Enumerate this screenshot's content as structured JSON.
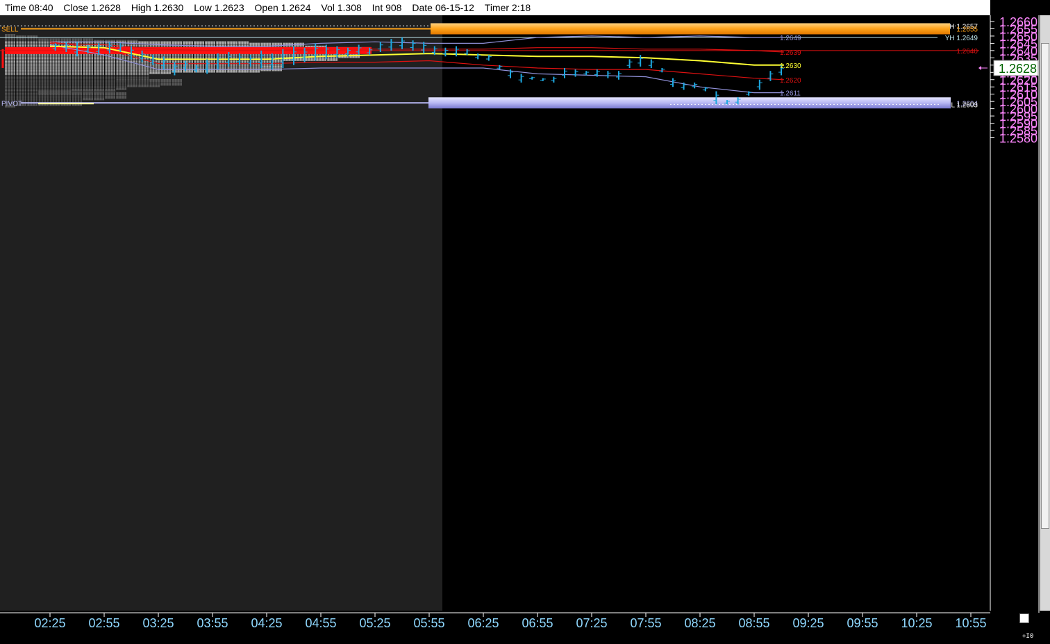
{
  "infobar": {
    "time": "Time 08:40",
    "close": "Close 1.2628",
    "high": "High 1.2630",
    "low": "Low 1.2623",
    "open": "Open 1.2624",
    "vol": "Vol 1.308",
    "int": "Int 908",
    "date": "Date 06-15-12",
    "timer": "Timer 2:18"
  },
  "corner_label": "+I0",
  "colors": {
    "background": "#000000",
    "premarket_shade": "#202020",
    "profile_light": "#a8a8a8",
    "profile_dark": "#565656",
    "bar": "#1ea8e0",
    "yellow": "#ffff33",
    "red": "#dd1111",
    "lavender": "#9090d8",
    "sell_band": "#ffa319",
    "pivot_band": "#b8b8f4",
    "price_axis_text": "#ff88ff",
    "time_axis_text": "#8fd8ff"
  },
  "chart_data": {
    "type": "bar",
    "subtype": "ohlc-price-chart-with-market-profile",
    "ylim": [
      1.2578,
      1.2662
    ],
    "price_ticks": [
      "1.2660",
      "1.2655",
      "1.2650",
      "1.2645",
      "1.2640",
      "1.2635",
      "1.2630",
      "1.2625",
      "1.2620",
      "1.2615",
      "1.2610",
      "1.2605",
      "1.2600",
      "1.2595",
      "1.2590",
      "1.2585",
      "1.2580"
    ],
    "time_ticks": [
      "02:25",
      "02:55",
      "03:25",
      "03:55",
      "04:25",
      "04:55",
      "05:25",
      "05:55",
      "06:25",
      "06:55",
      "07:25",
      "07:55",
      "08:25",
      "08:55",
      "09:25",
      "09:55",
      "10:25",
      "10:55"
    ],
    "current_price": "1.2628",
    "levels": [
      {
        "name": "high",
        "label": "H",
        "value": "1.2657",
        "style": "dotted"
      },
      {
        "name": "sell",
        "label": "SELL",
        "value": "1.2655",
        "style": "band"
      },
      {
        "name": "yesterday-high",
        "label": "YH",
        "value": "1.2649",
        "style": "line"
      },
      {
        "name": "pivot",
        "label": "PIVOT",
        "value": "1.2604",
        "style": "band"
      },
      {
        "name": "low",
        "label": "L",
        "value": "1.2603",
        "style": "dotted"
      },
      {
        "name": "red-level",
        "label": "",
        "value": "1.2640",
        "style": "line"
      }
    ],
    "series_labels": [
      {
        "value": "1.2649",
        "color": "lavender"
      },
      {
        "value": "1.2639",
        "color": "red"
      },
      {
        "value": "1.2630",
        "color": "yellow"
      },
      {
        "value": "1.2620",
        "color": "red"
      },
      {
        "value": "1.2611",
        "color": "lavender"
      }
    ],
    "bars": [
      {
        "x": 0.1,
        "h": 1.2645,
        "l": 1.264
      },
      {
        "x": 0.3,
        "h": 1.2646,
        "l": 1.2639
      },
      {
        "x": 0.5,
        "h": 1.2646,
        "l": 1.2636
      },
      {
        "x": 0.7,
        "h": 1.2644,
        "l": 1.2638
      },
      {
        "x": 0.9,
        "h": 1.2645,
        "l": 1.2637
      },
      {
        "x": 1.1,
        "h": 1.2646,
        "l": 1.2638
      },
      {
        "x": 1.3,
        "h": 1.2645,
        "l": 1.2639
      },
      {
        "x": 1.5,
        "h": 1.2643,
        "l": 1.2634
      },
      {
        "x": 1.7,
        "h": 1.264,
        "l": 1.2632
      },
      {
        "x": 1.9,
        "h": 1.2637,
        "l": 1.263
      },
      {
        "x": 2.1,
        "h": 1.2636,
        "l": 1.2627
      },
      {
        "x": 2.3,
        "h": 1.2632,
        "l": 1.2623
      },
      {
        "x": 2.5,
        "h": 1.2633,
        "l": 1.2626
      },
      {
        "x": 2.7,
        "h": 1.263,
        "l": 1.2625
      },
      {
        "x": 2.9,
        "h": 1.2634,
        "l": 1.2624
      },
      {
        "x": 3.1,
        "h": 1.2638,
        "l": 1.2627
      },
      {
        "x": 3.3,
        "h": 1.2639,
        "l": 1.2629
      },
      {
        "x": 3.5,
        "h": 1.2638,
        "l": 1.263
      },
      {
        "x": 3.7,
        "h": 1.2637,
        "l": 1.2629
      },
      {
        "x": 3.9,
        "h": 1.264,
        "l": 1.2628
      },
      {
        "x": 4.1,
        "h": 1.2638,
        "l": 1.2627
      },
      {
        "x": 4.3,
        "h": 1.2641,
        "l": 1.2628
      },
      {
        "x": 4.5,
        "h": 1.2643,
        "l": 1.263
      },
      {
        "x": 4.7,
        "h": 1.2642,
        "l": 1.2632
      },
      {
        "x": 4.9,
        "h": 1.2645,
        "l": 1.2633
      },
      {
        "x": 5.1,
        "h": 1.2644,
        "l": 1.2634
      },
      {
        "x": 5.3,
        "h": 1.2643,
        "l": 1.2635
      },
      {
        "x": 5.5,
        "h": 1.2642,
        "l": 1.2636
      },
      {
        "x": 5.7,
        "h": 1.2644,
        "l": 1.2637
      },
      {
        "x": 5.9,
        "h": 1.2642,
        "l": 1.2637
      },
      {
        "x": 6.1,
        "h": 1.2646,
        "l": 1.2639
      },
      {
        "x": 6.3,
        "h": 1.2648,
        "l": 1.264
      },
      {
        "x": 6.5,
        "h": 1.2649,
        "l": 1.2641
      },
      {
        "x": 6.7,
        "h": 1.2647,
        "l": 1.264
      },
      {
        "x": 6.9,
        "h": 1.2646,
        "l": 1.2638
      },
      {
        "x": 7.1,
        "h": 1.2643,
        "l": 1.2637
      },
      {
        "x": 7.3,
        "h": 1.2642,
        "l": 1.2636
      },
      {
        "x": 7.5,
        "h": 1.2643,
        "l": 1.2636
      },
      {
        "x": 7.7,
        "h": 1.2641,
        "l": 1.2637
      },
      {
        "x": 7.9,
        "h": 1.2638,
        "l": 1.2634
      },
      {
        "x": 8.1,
        "h": 1.2637,
        "l": 1.2633
      },
      {
        "x": 8.3,
        "h": 1.263,
        "l": 1.2627
      },
      {
        "x": 8.5,
        "h": 1.2627,
        "l": 1.2621
      },
      {
        "x": 8.7,
        "h": 1.2624,
        "l": 1.2618
      },
      {
        "x": 8.9,
        "h": 1.2622,
        "l": 1.262
      },
      {
        "x": 9.1,
        "h": 1.2621,
        "l": 1.2619
      },
      {
        "x": 9.3,
        "h": 1.2622,
        "l": 1.2618
      },
      {
        "x": 9.5,
        "h": 1.2628,
        "l": 1.2621
      },
      {
        "x": 9.7,
        "h": 1.2627,
        "l": 1.2622
      },
      {
        "x": 9.9,
        "h": 1.2626,
        "l": 1.2623
      },
      {
        "x": 10.1,
        "h": 1.2627,
        "l": 1.2622
      },
      {
        "x": 10.3,
        "h": 1.2626,
        "l": 1.2621
      },
      {
        "x": 10.5,
        "h": 1.2626,
        "l": 1.262
      },
      {
        "x": 10.7,
        "h": 1.2634,
        "l": 1.2628
      },
      {
        "x": 10.9,
        "h": 1.2637,
        "l": 1.2629
      },
      {
        "x": 11.1,
        "h": 1.2634,
        "l": 1.2628
      },
      {
        "x": 11.3,
        "h": 1.2628,
        "l": 1.2625
      },
      {
        "x": 11.5,
        "h": 1.2621,
        "l": 1.2615
      },
      {
        "x": 11.7,
        "h": 1.2618,
        "l": 1.2613
      },
      {
        "x": 11.9,
        "h": 1.2618,
        "l": 1.2614
      },
      {
        "x": 12.1,
        "h": 1.2615,
        "l": 1.2612
      },
      {
        "x": 12.3,
        "h": 1.2612,
        "l": 1.2603
      },
      {
        "x": 12.5,
        "h": 1.2606,
        "l": 1.2603
      },
      {
        "x": 12.7,
        "h": 1.2608,
        "l": 1.2603
      },
      {
        "x": 12.9,
        "h": 1.2612,
        "l": 1.2609
      },
      {
        "x": 13.1,
        "h": 1.262,
        "l": 1.2613
      },
      {
        "x": 13.3,
        "h": 1.2626,
        "l": 1.2619
      },
      {
        "x": 13.5,
        "h": 1.263,
        "l": 1.2623
      }
    ],
    "yellow_line": [
      [
        0.0,
        1.2643
      ],
      [
        1.0,
        1.2642
      ],
      [
        2.0,
        1.2634
      ],
      [
        3.0,
        1.2634
      ],
      [
        4.0,
        1.2634
      ],
      [
        5.0,
        1.2636
      ],
      [
        6.0,
        1.2637
      ],
      [
        7.0,
        1.2638
      ],
      [
        8.0,
        1.2637
      ],
      [
        9.0,
        1.2636
      ],
      [
        10.0,
        1.2636
      ],
      [
        11.0,
        1.2635
      ],
      [
        12.0,
        1.2633
      ],
      [
        13.0,
        1.263
      ],
      [
        13.55,
        1.263
      ]
    ],
    "red_upper_line": [
      [
        0.0,
        1.2645
      ],
      [
        1.0,
        1.2644
      ],
      [
        2.0,
        1.2641
      ],
      [
        3.0,
        1.264
      ],
      [
        4.0,
        1.264
      ],
      [
        5.0,
        1.2641
      ],
      [
        6.0,
        1.2641
      ],
      [
        7.0,
        1.2641
      ],
      [
        8.0,
        1.2641
      ],
      [
        9.0,
        1.2642
      ],
      [
        10.0,
        1.2642
      ],
      [
        11.0,
        1.2641
      ],
      [
        12.0,
        1.2641
      ],
      [
        13.0,
        1.264
      ],
      [
        13.55,
        1.2639
      ]
    ],
    "red_lower_line": [
      [
        0.0,
        1.2646
      ],
      [
        1.0,
        1.2641
      ],
      [
        2.0,
        1.2631
      ],
      [
        3.0,
        1.2631
      ],
      [
        4.0,
        1.2631
      ],
      [
        5.0,
        1.2632
      ],
      [
        6.0,
        1.2632
      ],
      [
        7.0,
        1.2633
      ],
      [
        8.0,
        1.263
      ],
      [
        9.0,
        1.2628
      ],
      [
        10.0,
        1.2627
      ],
      [
        11.0,
        1.2627
      ],
      [
        12.0,
        1.2624
      ],
      [
        13.0,
        1.2621
      ],
      [
        13.55,
        1.262
      ]
    ],
    "lavender_upper_line": [
      [
        0.0,
        1.2646
      ],
      [
        1.0,
        1.2646
      ],
      [
        2.0,
        1.2644
      ],
      [
        3.0,
        1.2643
      ],
      [
        4.0,
        1.2643
      ],
      [
        5.0,
        1.2645
      ],
      [
        6.0,
        1.2646
      ],
      [
        7.0,
        1.2645
      ],
      [
        8.0,
        1.2645
      ],
      [
        9.0,
        1.2649
      ],
      [
        10.0,
        1.265
      ],
      [
        11.0,
        1.2649
      ],
      [
        12.0,
        1.265
      ],
      [
        13.0,
        1.2649
      ],
      [
        13.55,
        1.2649
      ]
    ],
    "lavender_lower_line": [
      [
        0.0,
        1.2644
      ],
      [
        1.0,
        1.2637
      ],
      [
        2.0,
        1.2627
      ],
      [
        3.0,
        1.2627
      ],
      [
        4.0,
        1.2627
      ],
      [
        5.0,
        1.2628
      ],
      [
        6.0,
        1.2628
      ],
      [
        7.0,
        1.2628
      ],
      [
        8.0,
        1.2628
      ],
      [
        9.0,
        1.2624
      ],
      [
        10.0,
        1.2623
      ],
      [
        11.0,
        1.2622
      ],
      [
        12.0,
        1.2615
      ],
      [
        13.0,
        1.2611
      ],
      [
        13.55,
        1.2611
      ]
    ],
    "profile": [
      {
        "p": 1.2649,
        "n": 1,
        "tone": "dark"
      },
      {
        "p": 1.2648,
        "n": 3,
        "tone": "dark"
      },
      {
        "p": 1.2647,
        "n": 3,
        "tone": "dark"
      },
      {
        "p": 1.2646,
        "n": 8,
        "tone": "dark"
      },
      {
        "p": 1.2645,
        "n": 12,
        "tone": "dark"
      },
      {
        "p": 1.2644,
        "n": 22,
        "tone": "light"
      },
      {
        "p": 1.2643,
        "n": 27,
        "tone": "light"
      },
      {
        "p": 1.2642,
        "n": 26,
        "tone": "light"
      },
      {
        "p": 1.2641,
        "n": 29,
        "tone": "light"
      },
      {
        "p": 1.264,
        "n": 33,
        "tone": "light"
      },
      {
        "p": 1.2639,
        "n": 30,
        "tone": "light"
      },
      {
        "p": 1.2638,
        "n": 31,
        "tone": "light"
      },
      {
        "p": 1.2637,
        "n": 32,
        "tone": "light"
      },
      {
        "p": 1.2636,
        "n": 30,
        "tone": "light"
      },
      {
        "p": 1.2635,
        "n": 30,
        "tone": "light"
      },
      {
        "p": 1.2634,
        "n": 25,
        "tone": "light"
      },
      {
        "p": 1.2633,
        "n": 24,
        "tone": "light"
      },
      {
        "p": 1.2632,
        "n": 25,
        "tone": "light"
      },
      {
        "p": 1.2631,
        "n": 25,
        "tone": "light"
      },
      {
        "p": 1.263,
        "n": 25,
        "tone": "light"
      },
      {
        "p": 1.2629,
        "n": 23,
        "tone": "light"
      },
      {
        "p": 1.2628,
        "n": 25,
        "tone": "light"
      },
      {
        "p": 1.2627,
        "n": 23,
        "tone": "light"
      },
      {
        "p": 1.2626,
        "n": 15,
        "tone": "light"
      },
      {
        "p": 1.2625,
        "n": 13,
        "tone": "light"
      },
      {
        "p": 1.2624,
        "n": 13,
        "tone": "light"
      },
      {
        "p": 1.2623,
        "n": 13,
        "tone": "light"
      },
      {
        "p": 1.2622,
        "n": 13,
        "tone": "light"
      },
      {
        "p": 1.2621,
        "n": 13,
        "tone": "dark"
      },
      {
        "p": 1.262,
        "n": 10,
        "tone": "dark"
      },
      {
        "p": 1.2619,
        "n": 13,
        "tone": "dark"
      },
      {
        "p": 1.2618,
        "n": 16,
        "tone": "dark"
      },
      {
        "p": 1.2617,
        "n": 14,
        "tone": "dark"
      },
      {
        "p": 1.2616,
        "n": 11,
        "tone": "dark"
      },
      {
        "p": 1.2615,
        "n": 11,
        "tone": "dark"
      },
      {
        "p": 1.2614,
        "n": 10,
        "tone": "dark"
      },
      {
        "p": 1.2613,
        "n": 6,
        "tone": "dark"
      },
      {
        "p": 1.2612,
        "n": 3,
        "tone": "dark"
      },
      {
        "p": 1.2611,
        "n": 3,
        "tone": "dark"
      },
      {
        "p": 1.261,
        "n": 3,
        "tone": "dark"
      },
      {
        "p": 1.2609,
        "n": 11,
        "tone": "dark"
      },
      {
        "p": 1.2608,
        "n": 9,
        "tone": "dark"
      },
      {
        "p": 1.2607,
        "n": 7,
        "tone": "dark"
      },
      {
        "p": 1.2606,
        "n": 7,
        "tone": "dark"
      },
      {
        "p": 1.2605,
        "n": 7,
        "tone": "dark"
      },
      {
        "p": 1.2604,
        "n": 7,
        "tone": "dark"
      },
      {
        "p": 1.2603,
        "n": 1,
        "tone": "dark"
      }
    ]
  }
}
